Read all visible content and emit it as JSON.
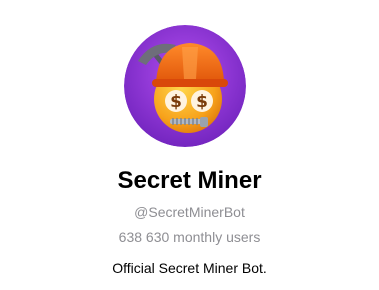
{
  "profile": {
    "avatar_icon": "miner-emoji-avatar-icon",
    "name": "Secret Miner",
    "username": "@SecretMinerBot",
    "monthly_users": "638 630 monthly users",
    "description": "Official Secret Miner Bot."
  },
  "colors": {
    "avatar_background": "#8a2fd0",
    "name_text": "#000000",
    "secondary_text": "#8e8e93"
  }
}
